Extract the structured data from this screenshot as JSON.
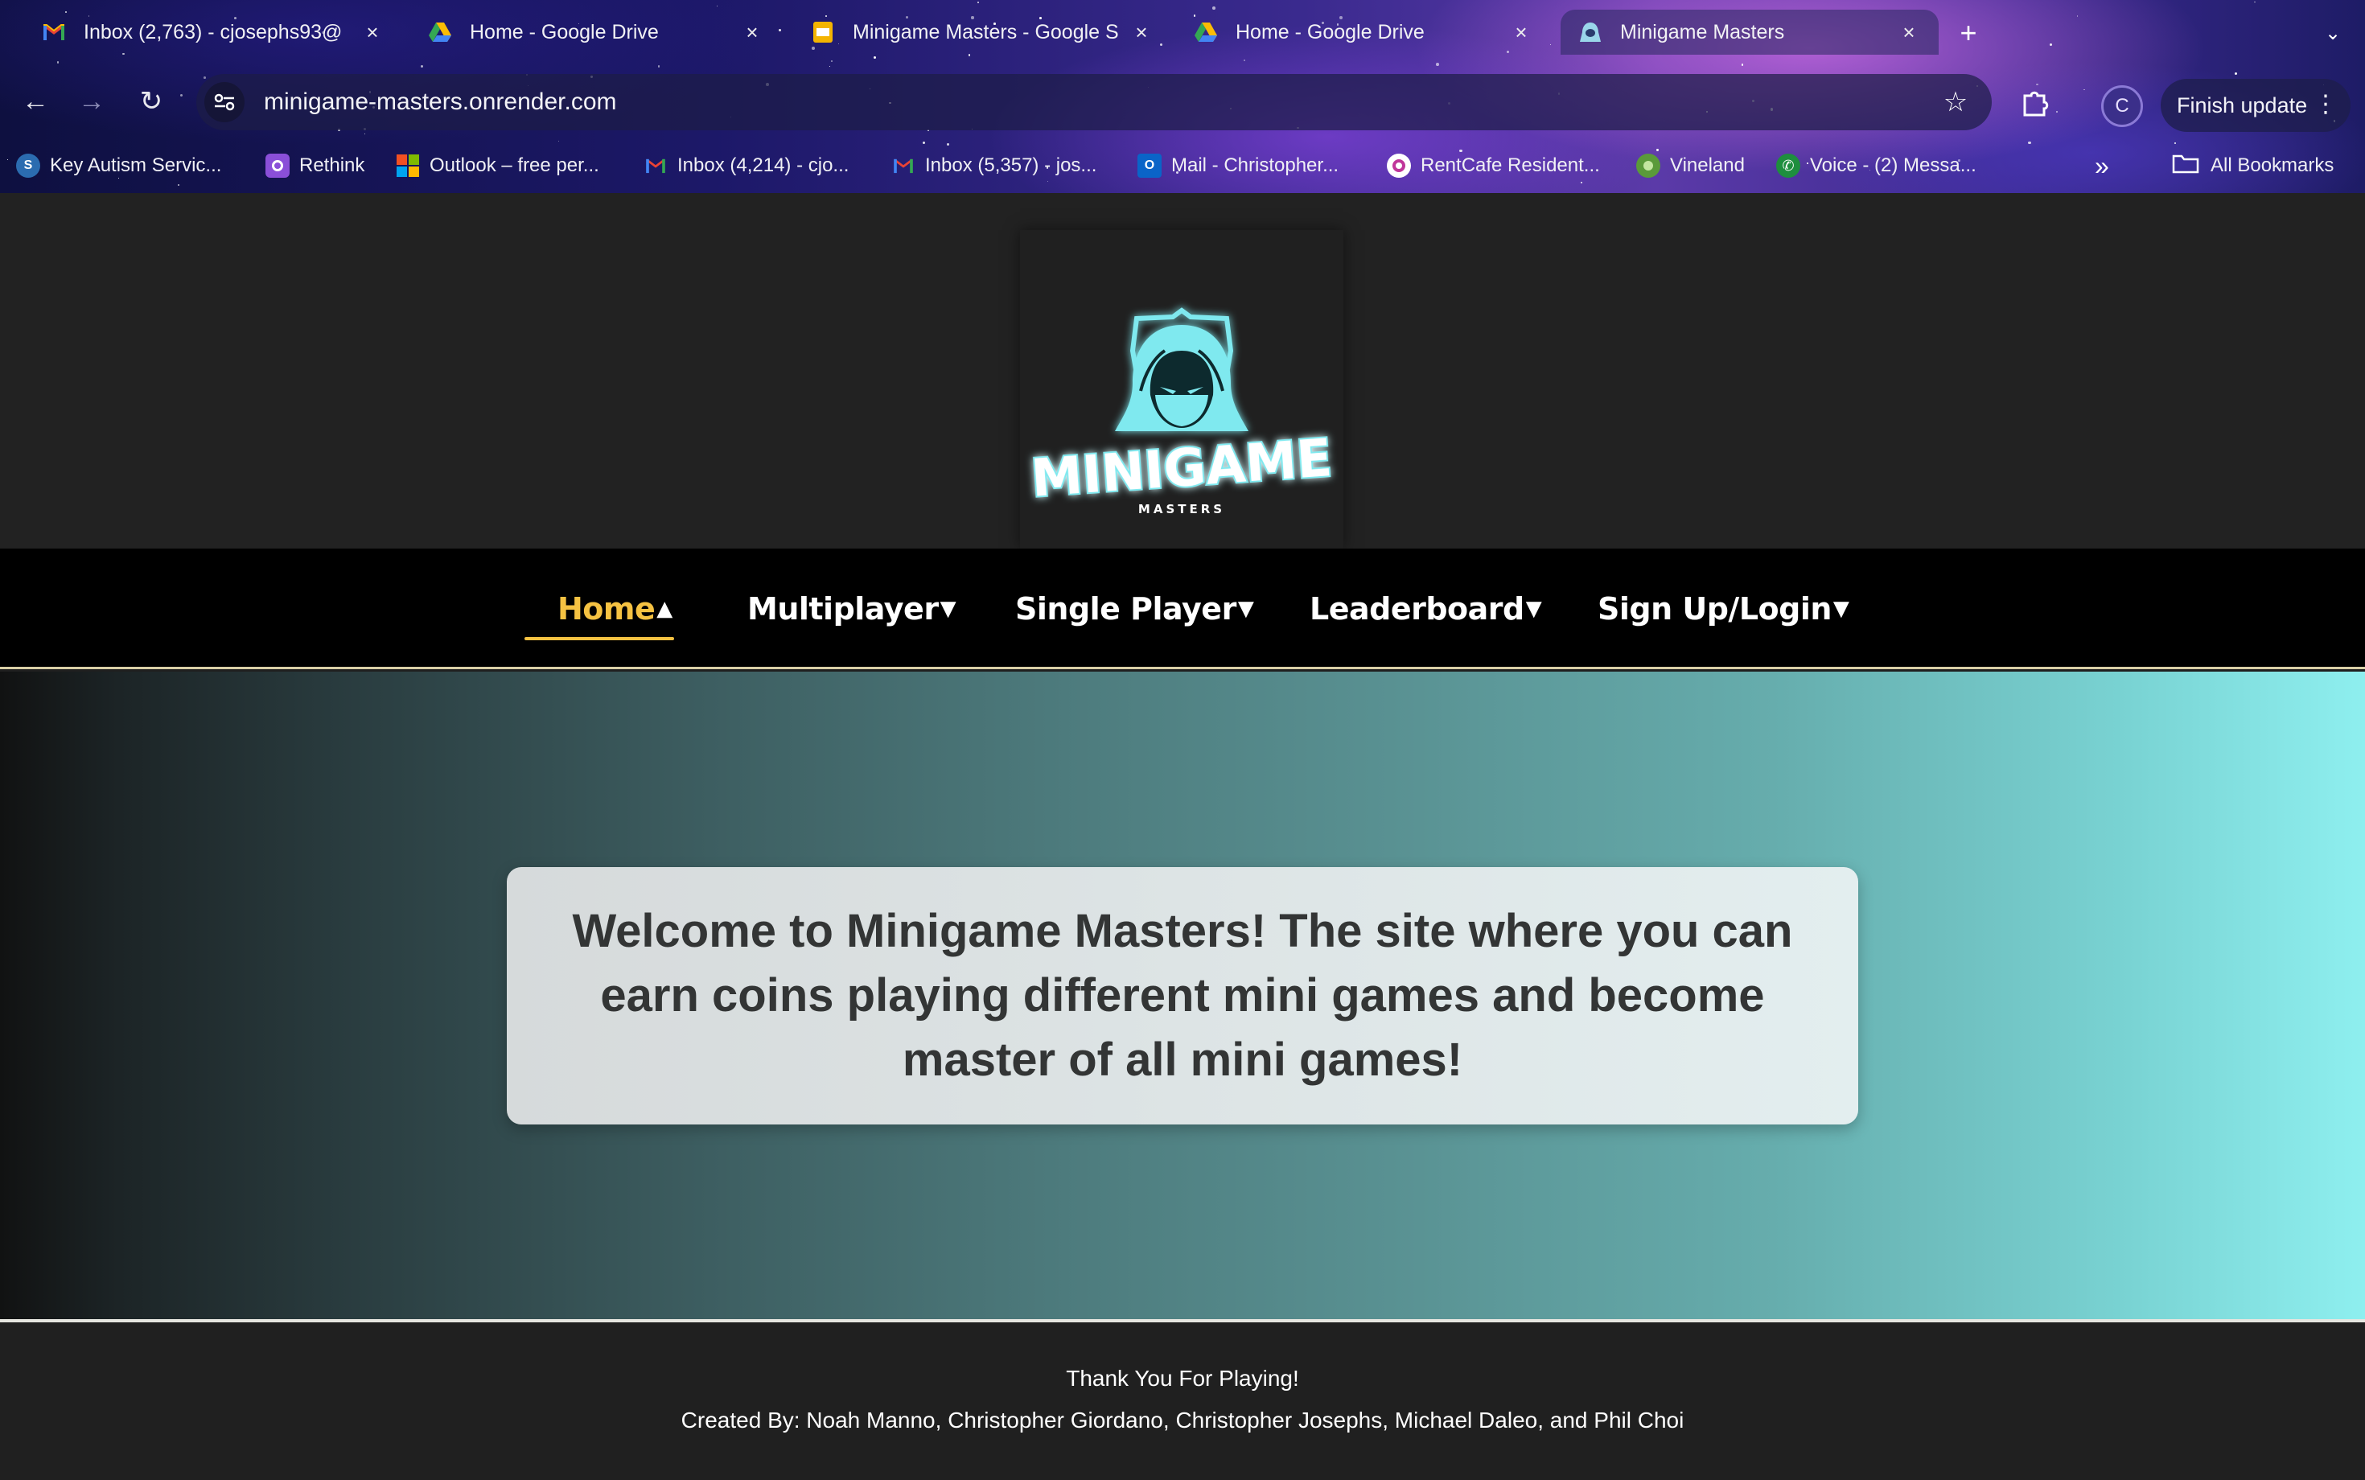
{
  "browser": {
    "tabs": [
      {
        "title": "Inbox (2,763) - cjosephs93@",
        "icon": "gmail-icon",
        "active": false
      },
      {
        "title": "Home - Google Drive",
        "icon": "google-drive-icon",
        "active": false
      },
      {
        "title": "Minigame Masters - Google S",
        "icon": "google-slides-icon",
        "active": false
      },
      {
        "title": "Home - Google Drive",
        "icon": "google-drive-icon",
        "active": false
      },
      {
        "title": "Minigame Masters",
        "icon": "site-icon",
        "active": true
      }
    ],
    "url": "minigame-masters.onrender.com",
    "profile_initial": "C",
    "finish_update_label": "Finish update",
    "bookmarks": [
      {
        "label": "Key Autism Servic...",
        "icon": "key-autism-icon"
      },
      {
        "label": "Rethink",
        "icon": "rethink-icon"
      },
      {
        "label": "Outlook – free per...",
        "icon": "microsoft-icon"
      },
      {
        "label": "Inbox (4,214) - cjo...",
        "icon": "gmail-icon"
      },
      {
        "label": "Inbox (5,357) - jos...",
        "icon": "gmail-icon"
      },
      {
        "label": "Mail - Christopher...",
        "icon": "outlook-icon"
      },
      {
        "label": "RentCafe Resident...",
        "icon": "rentcafe-icon"
      },
      {
        "label": "Vineland",
        "icon": "vineland-icon"
      },
      {
        "label": "Voice - (2) Messa...",
        "icon": "google-voice-icon"
      }
    ],
    "all_bookmarks_label": "All Bookmarks",
    "colors": {
      "accent_yellow": "#f5c242",
      "logo_cyan": "#7fe9ef"
    }
  },
  "site": {
    "logo_text": "MINIGAME",
    "logo_subtext": "MASTERS",
    "nav": [
      {
        "label": "Home",
        "arrow": "▲",
        "active": true
      },
      {
        "label": "Multiplayer",
        "arrow": "▼",
        "active": false
      },
      {
        "label": "Single Player",
        "arrow": "▼",
        "active": false
      },
      {
        "label": "Leaderboard",
        "arrow": "▼",
        "active": false
      },
      {
        "label": "Sign Up/Login",
        "arrow": "▼",
        "active": false
      }
    ],
    "welcome_text": "Welcome to Minigame Masters! The site where you can earn coins playing different mini games and become master of all mini games!",
    "footer": {
      "thanks": "Thank You For Playing!",
      "credits": "Created By: Noah Manno, Christopher Giordano, Christopher Josephs, Michael Daleo, and Phil Choi"
    }
  }
}
